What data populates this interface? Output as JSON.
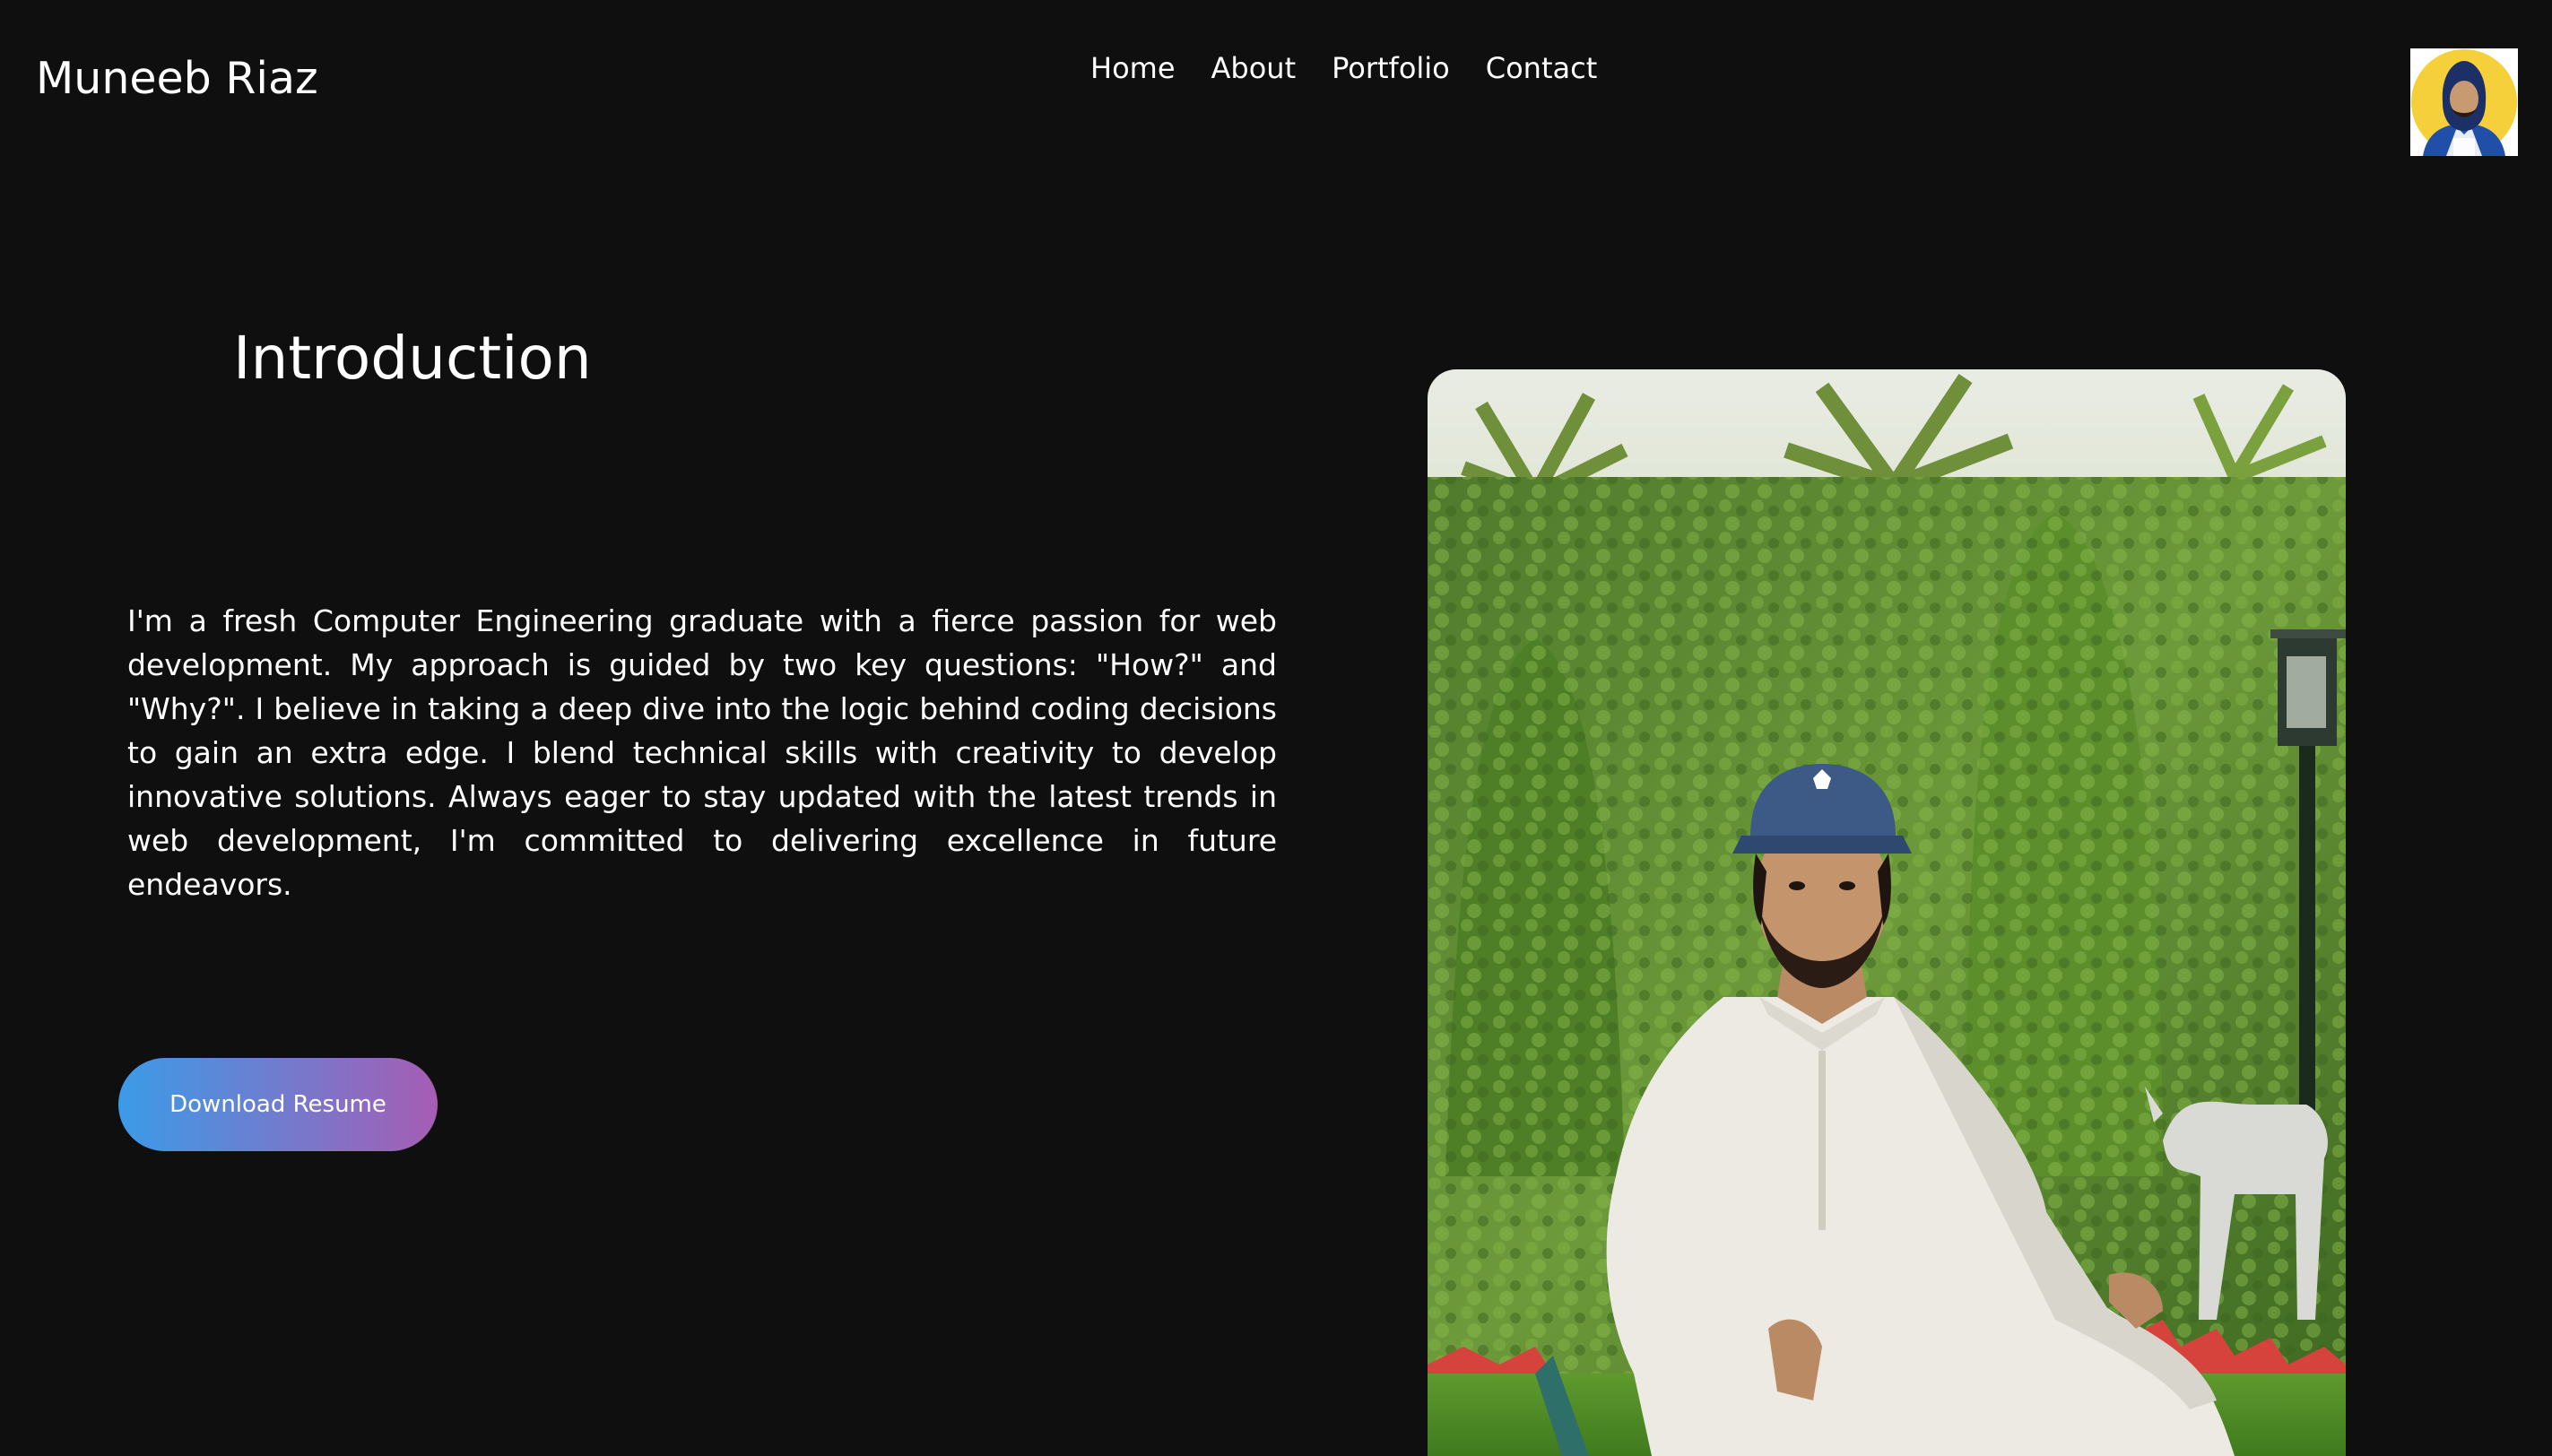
{
  "header": {
    "brand": "Muneeb Riaz",
    "nav": [
      "Home",
      "About",
      "Portfolio",
      "Contact"
    ],
    "avatar_icon": "profile-avatar"
  },
  "intro": {
    "title": "Introduction",
    "paragraph": "I'm a fresh Computer Engineering graduate with a fierce passion for web development. My approach is guided by two key questions: \"How?\" and \"Why?\". I believe in taking a deep dive into the logic behind coding decisions to gain an extra edge. I blend technical skills with creativity to develop innovative solutions. Always eager to stay updated with the latest trends in web development, I'm committed to delivering excellence in future endeavors.",
    "download_label": "Download Resume"
  },
  "colors": {
    "background": "#0f0f0f",
    "text": "#ffffff",
    "button_gradient_start": "#3b9be8",
    "button_gradient_end": "#a65db4",
    "avatar_ring": "#f5d03b"
  }
}
